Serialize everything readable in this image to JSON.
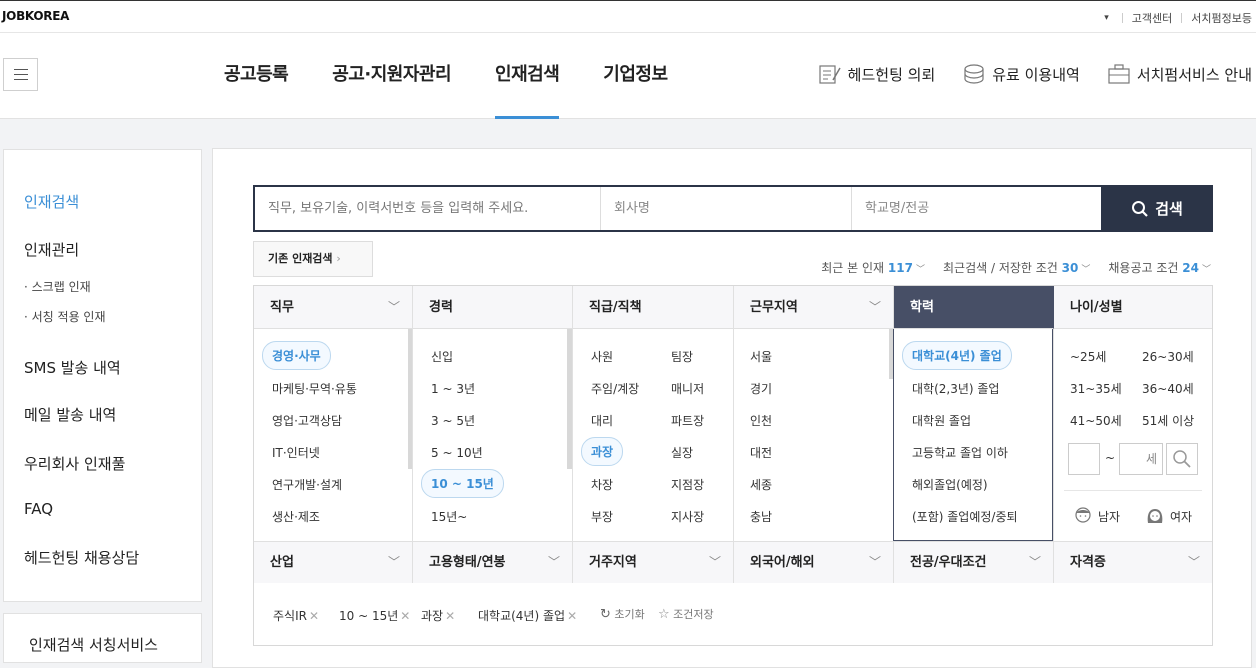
{
  "brand": "JOBKOREA",
  "toplinks": {
    "customer": "고객센터",
    "searchfirm": "서치펌정보등"
  },
  "gnb": [
    "공고등록",
    "공고·지원자관리",
    "인재검색",
    "기업정보"
  ],
  "util": {
    "headhunting": "헤드헌팅 의뢰",
    "paid": "유료 이용내역",
    "service": "서치펌서비스 안내"
  },
  "lnb": {
    "items": [
      "인재검색",
      "인재관리",
      "SMS 발송 내역",
      "메일 발송 내역",
      "우리회사 인재풀",
      "FAQ",
      "헤드헌팅 채용상담"
    ],
    "subs": [
      "스크랩 인재",
      "서칭 적용 인재"
    ],
    "extra": "인재검색 서칭서비스"
  },
  "search": {
    "keyword_placeholder": "직무, 보유기술, 이력서번호 등을 입력해 주세요.",
    "company_placeholder": "회사명",
    "school_placeholder": "학교명/전공",
    "button": "검색"
  },
  "prev_search": "기존 인재검색",
  "recent": {
    "viewed_label": "최근 본 인재",
    "viewed_count": "117",
    "saved_label": "최근검색 / 저장한 조건",
    "saved_count": "30",
    "posting_label": "채용공고 조건",
    "posting_count": "24"
  },
  "headers": [
    "직무",
    "경력",
    "직급/직책",
    "근무지역",
    "학력",
    "나이/성별"
  ],
  "job": [
    "경영·사무",
    "마케팅·무역·유통",
    "영업·고객상담",
    "IT·인터넷",
    "연구개발·설계",
    "생산·제조"
  ],
  "career": [
    "신입",
    "1 ~ 3년",
    "3 ~ 5년",
    "5 ~ 10년",
    "10 ~ 15년",
    "15년~"
  ],
  "rank_left": [
    "사원",
    "주임/계장",
    "대리",
    "과장",
    "차장",
    "부장"
  ],
  "rank_right": [
    "팀장",
    "매니저",
    "파트장",
    "실장",
    "지점장",
    "지사장"
  ],
  "region": [
    "서울",
    "경기",
    "인천",
    "대전",
    "세종",
    "충남"
  ],
  "edu": [
    "대학교(4년) 졸업",
    "대학(2,3년) 졸업",
    "대학원 졸업",
    "고등학교 졸업 이하",
    "해외졸업(예정)",
    "(포함) 졸업예정/중퇴"
  ],
  "age_left": [
    "~25세",
    "31~35세",
    "41~50세"
  ],
  "age_right": [
    "26~30세",
    "36~40세",
    "51세 이상"
  ],
  "age_tilde": "~",
  "age_unit": "세",
  "gender": {
    "male": "남자",
    "female": "여자"
  },
  "row2": [
    "산업",
    "고용형태/연봉",
    "거주지역",
    "외국어/해외",
    "전공/우대조건",
    "자격증"
  ],
  "tags": [
    "주식IR",
    "10 ~ 15년",
    "과장",
    "대학교(4년) 졸업"
  ],
  "tag_close": "✕",
  "actions": {
    "reset": "초기화",
    "save": "조건저장"
  },
  "colors": {
    "accent": "#3b8fd6",
    "navy": "#2b3447",
    "header_selected": "#474f66"
  }
}
